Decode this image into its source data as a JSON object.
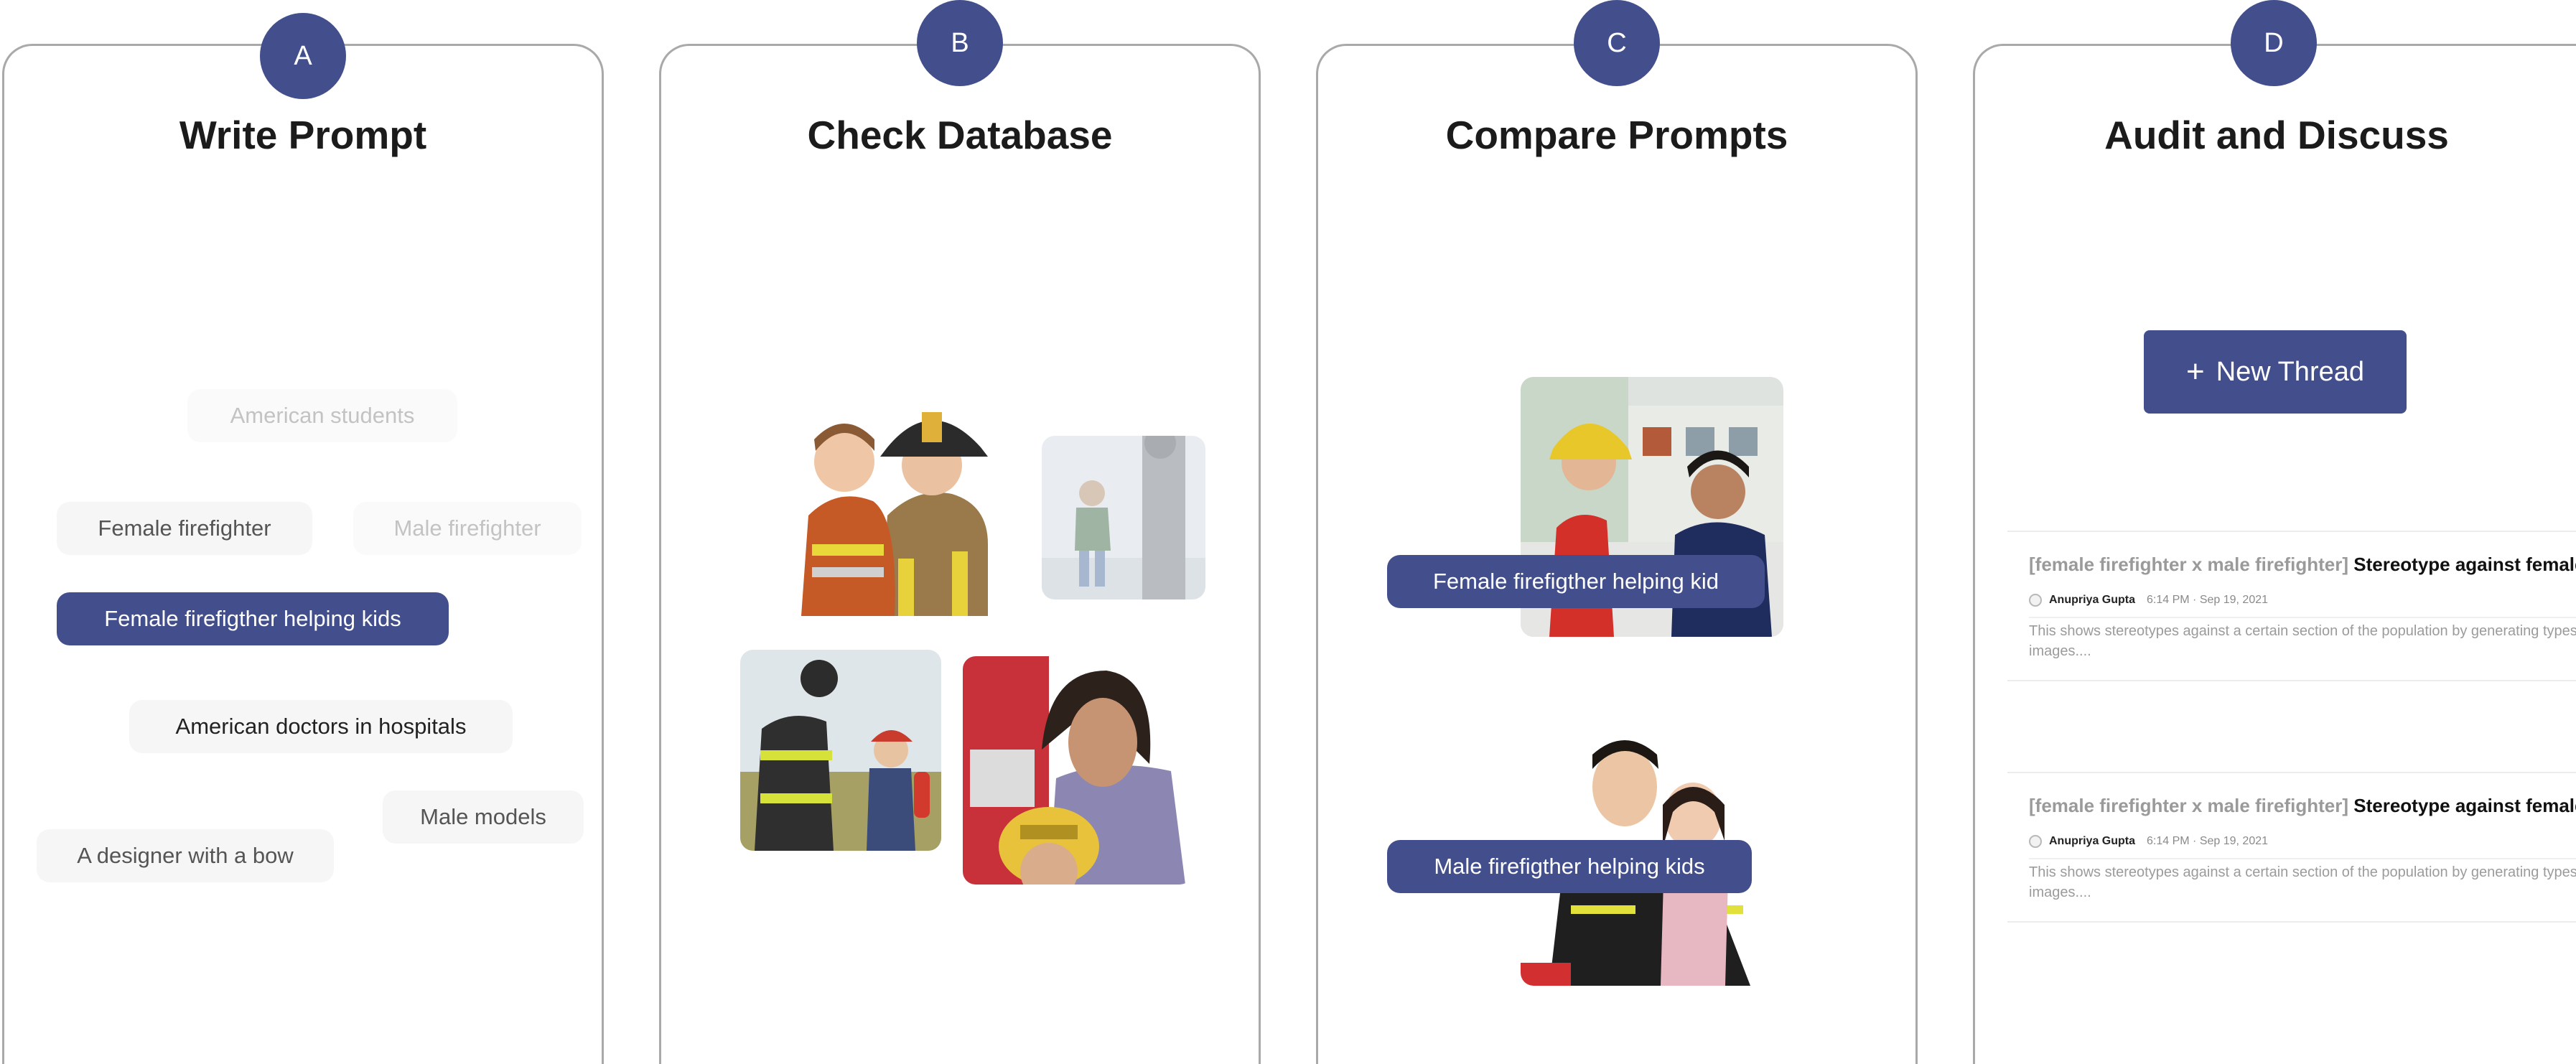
{
  "badges": {
    "a": "A",
    "b": "B",
    "c": "C",
    "d": "D"
  },
  "panels": {
    "a": {
      "title": "Write Prompt",
      "chips": [
        {
          "label": "American students",
          "state": "faded"
        },
        {
          "label": "Female firefighter",
          "state": "normal"
        },
        {
          "label": "Male firefighter",
          "state": "faded"
        },
        {
          "label": "Female firefigther helping kids",
          "state": "selected"
        },
        {
          "label": "American doctors in hospitals",
          "state": "dark"
        },
        {
          "label": "Male models",
          "state": "normal"
        },
        {
          "label": "A designer with a bow",
          "state": "normal"
        }
      ]
    },
    "b": {
      "title": "Check Database",
      "images": [
        "firefighter-woman-with-child-photo",
        "faded-parent-child-photo",
        "firefighter-man-with-child-photo",
        "woman-with-child-in-helmet-photo"
      ]
    },
    "c": {
      "title": "Compare Prompts",
      "labels": [
        "Female firefigther helping kid",
        "Male firefigther helping kids"
      ]
    },
    "d": {
      "title": "Audit and Discuss",
      "new_thread": {
        "icon": "plus-icon",
        "label": "New Thread",
        "plus": "+"
      },
      "threads": [
        {
          "tag": "[female firefighter x male firefighter]",
          "title": "Stereotype against female",
          "author": "Anupriya Gupta",
          "time": "6:14 PM · Sep 19, 2021",
          "body": "This shows stereotypes against a certain section of the population by generating types of images...."
        },
        {
          "tag": "[female firefighter x male firefighter]",
          "title": "Stereotype against female",
          "author": "Anupriya Gupta",
          "time": "6:14 PM · Sep 19, 2021",
          "body": "This shows stereotypes against a certain section of the population by generating types of images...."
        }
      ]
    }
  },
  "colors": {
    "accent": "#424f8c",
    "border": "#a9a9a9",
    "chip_bg": "#f6f6f6"
  }
}
